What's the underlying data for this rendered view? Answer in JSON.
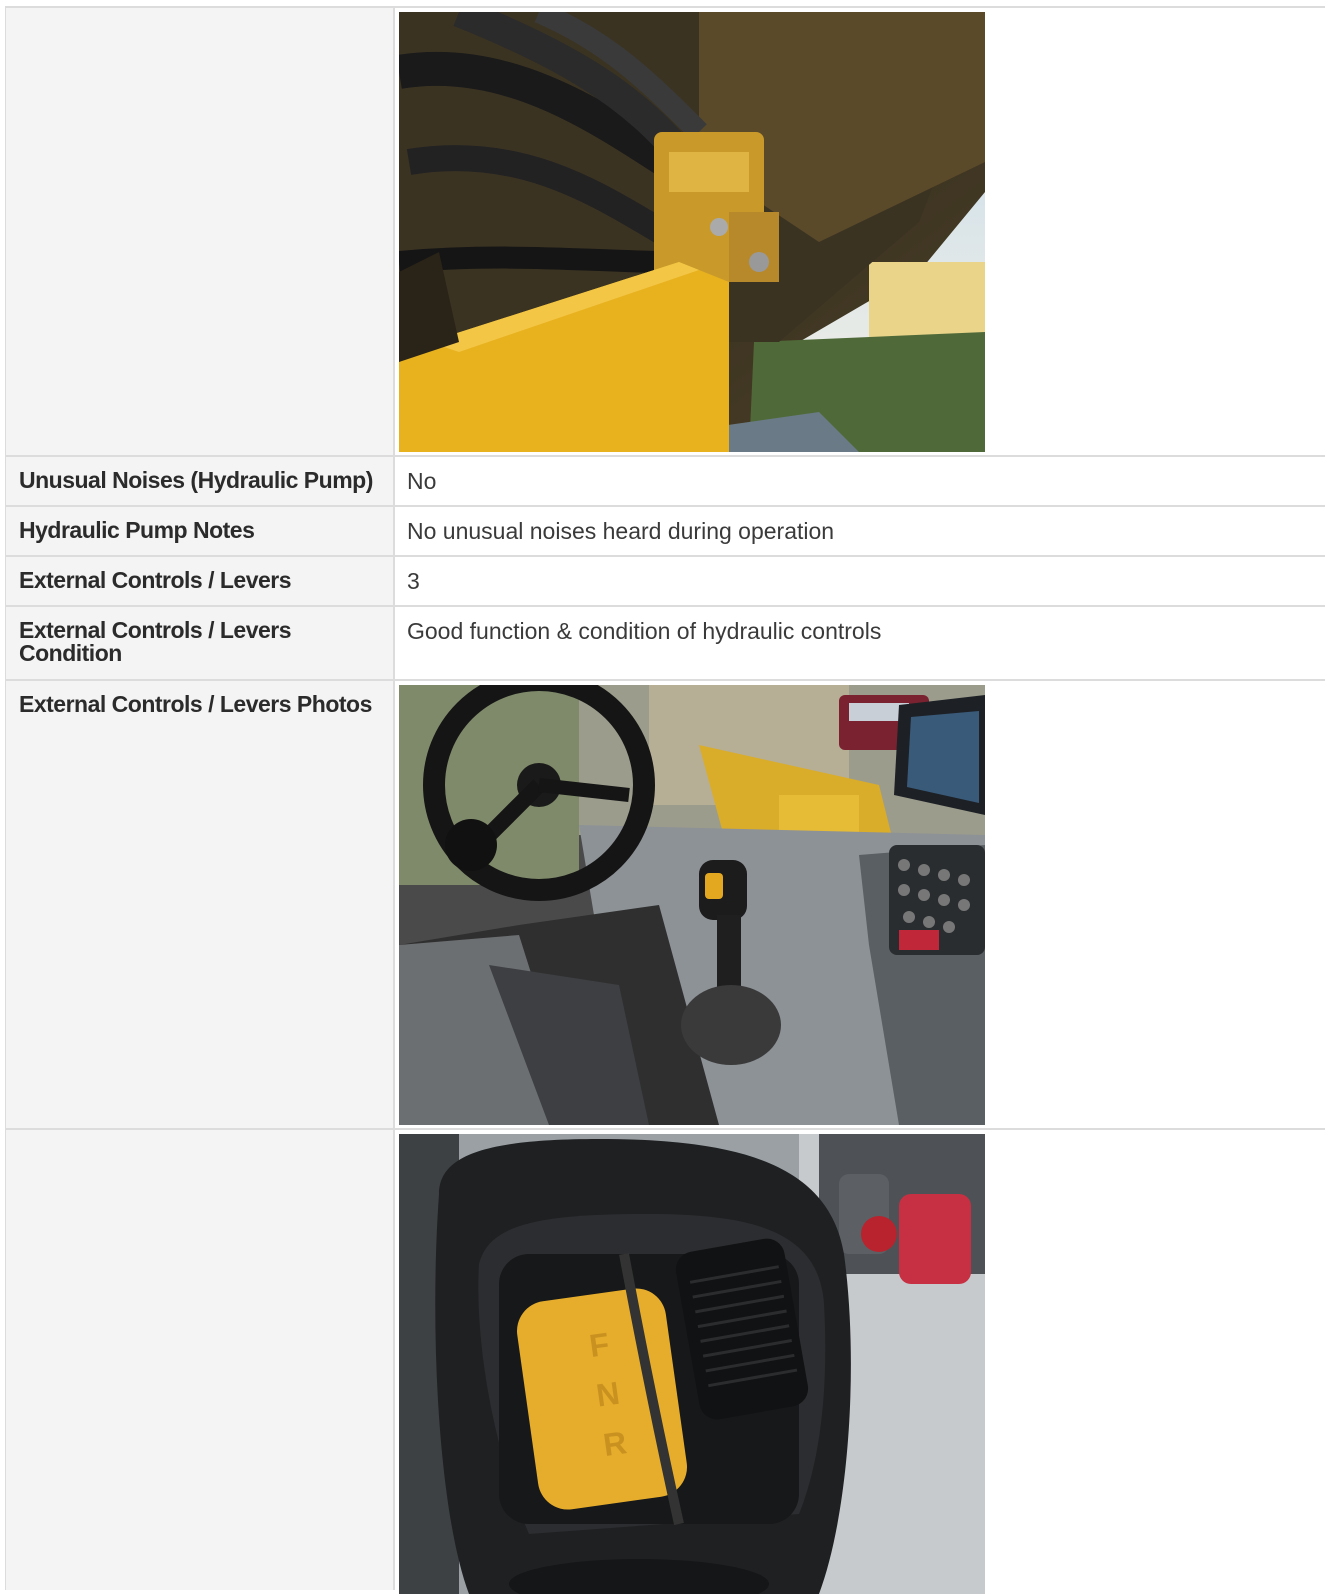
{
  "rows": [
    {
      "type": "photo",
      "label": "",
      "photo": "hydraulic-pump-photo"
    },
    {
      "type": "text",
      "label": "Unusual Noises (Hydraulic Pump)",
      "value": "No"
    },
    {
      "type": "text",
      "label": "Hydraulic Pump Notes",
      "value": "No unusual noises heard during operation"
    },
    {
      "type": "text",
      "label": "External Controls / Levers",
      "value": "3"
    },
    {
      "type": "text",
      "label": "External Controls / Levers Condition",
      "value": "Good function & condition of hydraulic controls"
    },
    {
      "type": "photo",
      "label": "External Controls / Levers Photos",
      "photo": "cab-controls-photo"
    },
    {
      "type": "photo",
      "label": "",
      "photo": "joystick-fnr-photo"
    }
  ],
  "colors": {
    "machine_yellow": "#e8b21f",
    "label_background": "#f4f4f4",
    "border": "#dcdcdc"
  }
}
